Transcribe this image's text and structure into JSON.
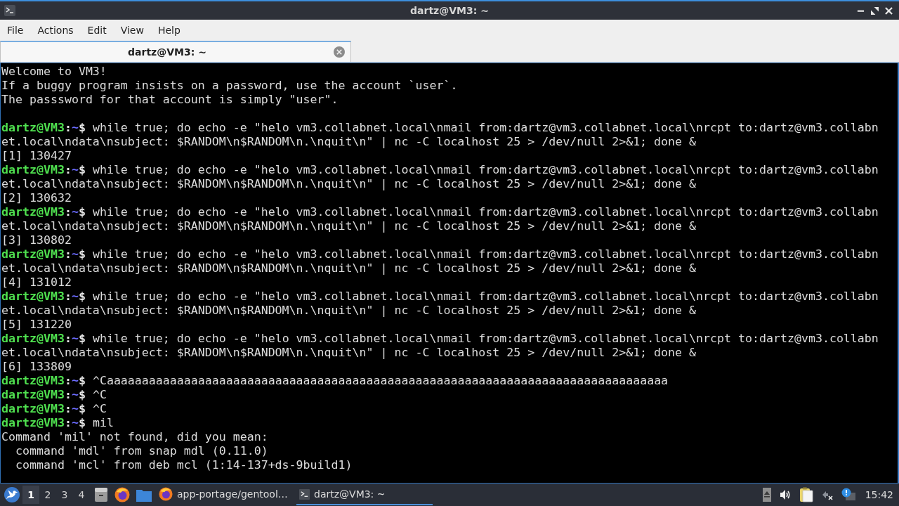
{
  "window": {
    "title": "dartz@VM3: ~"
  },
  "menu": [
    "File",
    "Actions",
    "Edit",
    "View",
    "Help"
  ],
  "tabs": [
    {
      "label": "dartz@VM3: ~",
      "selected": true
    }
  ],
  "terminal": {
    "lines": [
      {
        "kind": "output",
        "text": "Welcome to VM3!"
      },
      {
        "kind": "output",
        "text": "If a buggy program insists on a password, use the account `user`."
      },
      {
        "kind": "output",
        "text": "The passsword for that account is simply \"user\"."
      },
      {
        "kind": "blank"
      },
      {
        "kind": "prompt",
        "user": "dartz@VM3",
        "separator": ":",
        "dir": "~",
        "sign": "$",
        "command": "while true; do echo -e \"helo vm3.collabnet.local\\nmail from:dartz@vm3.collabnet.local\\nrcpt to:dartz@vm3.collabn"
      },
      {
        "kind": "output",
        "text": "et.local\\ndata\\nsubject: $RANDOM\\n$RANDOM\\n.\\nquit\\n\" | nc -C localhost 25 > /dev/null 2>&1; done &"
      },
      {
        "kind": "output",
        "text": "[1] 130427"
      },
      {
        "kind": "prompt",
        "user": "dartz@VM3",
        "separator": ":",
        "dir": "~",
        "sign": "$",
        "command": "while true; do echo -e \"helo vm3.collabnet.local\\nmail from:dartz@vm3.collabnet.local\\nrcpt to:dartz@vm3.collabn"
      },
      {
        "kind": "output",
        "text": "et.local\\ndata\\nsubject: $RANDOM\\n$RANDOM\\n.\\nquit\\n\" | nc -C localhost 25 > /dev/null 2>&1; done &"
      },
      {
        "kind": "output",
        "text": "[2] 130632"
      },
      {
        "kind": "prompt",
        "user": "dartz@VM3",
        "separator": ":",
        "dir": "~",
        "sign": "$",
        "command": "while true; do echo -e \"helo vm3.collabnet.local\\nmail from:dartz@vm3.collabnet.local\\nrcpt to:dartz@vm3.collabn"
      },
      {
        "kind": "output",
        "text": "et.local\\ndata\\nsubject: $RANDOM\\n$RANDOM\\n.\\nquit\\n\" | nc -C localhost 25 > /dev/null 2>&1; done &"
      },
      {
        "kind": "output",
        "text": "[3] 130802"
      },
      {
        "kind": "prompt",
        "user": "dartz@VM3",
        "separator": ":",
        "dir": "~",
        "sign": "$",
        "command": "while true; do echo -e \"helo vm3.collabnet.local\\nmail from:dartz@vm3.collabnet.local\\nrcpt to:dartz@vm3.collabn"
      },
      {
        "kind": "output",
        "text": "et.local\\ndata\\nsubject: $RANDOM\\n$RANDOM\\n.\\nquit\\n\" | nc -C localhost 25 > /dev/null 2>&1; done &"
      },
      {
        "kind": "output",
        "text": "[4] 131012"
      },
      {
        "kind": "prompt",
        "user": "dartz@VM3",
        "separator": ":",
        "dir": "~",
        "sign": "$",
        "command": "while true; do echo -e \"helo vm3.collabnet.local\\nmail from:dartz@vm3.collabnet.local\\nrcpt to:dartz@vm3.collabn"
      },
      {
        "kind": "output",
        "text": "et.local\\ndata\\nsubject: $RANDOM\\n$RANDOM\\n.\\nquit\\n\" | nc -C localhost 25 > /dev/null 2>&1; done &"
      },
      {
        "kind": "output",
        "text": "[5] 131220"
      },
      {
        "kind": "prompt",
        "user": "dartz@VM3",
        "separator": ":",
        "dir": "~",
        "sign": "$",
        "command": "while true; do echo -e \"helo vm3.collabnet.local\\nmail from:dartz@vm3.collabnet.local\\nrcpt to:dartz@vm3.collabn"
      },
      {
        "kind": "output",
        "text": "et.local\\ndata\\nsubject: $RANDOM\\n$RANDOM\\n.\\nquit\\n\" | nc -C localhost 25 > /dev/null 2>&1; done &"
      },
      {
        "kind": "output",
        "text": "[6] 133809"
      },
      {
        "kind": "prompt",
        "user": "dartz@VM3",
        "separator": ":",
        "dir": "~",
        "sign": "$",
        "command": "^Caaaaaaaaaaaaaaaaaaaaaaaaaaaaaaaaaaaaaaaaaaaaaaaaaaaaaaaaaaaaaaaaaaaaaaaaaaaaaaaa"
      },
      {
        "kind": "prompt",
        "user": "dartz@VM3",
        "separator": ":",
        "dir": "~",
        "sign": "$",
        "command": "^C"
      },
      {
        "kind": "prompt",
        "user": "dartz@VM3",
        "separator": ":",
        "dir": "~",
        "sign": "$",
        "command": "^C"
      },
      {
        "kind": "prompt",
        "user": "dartz@VM3",
        "separator": ":",
        "dir": "~",
        "sign": "$",
        "command": "mil"
      },
      {
        "kind": "output",
        "text": "Command 'mil' not found, did you mean:"
      },
      {
        "kind": "output",
        "text": "  command 'mdl' from snap mdl (0.11.0)"
      },
      {
        "kind": "output",
        "text": "  command 'mcl' from deb mcl (1:14-137+ds-9build1)"
      }
    ]
  },
  "taskbar": {
    "workspaces": [
      {
        "label": "1",
        "selected": true
      },
      {
        "label": "2",
        "selected": false
      },
      {
        "label": "3",
        "selected": false
      },
      {
        "label": "4",
        "selected": false
      }
    ],
    "tasks": [
      {
        "kind": "browser",
        "label": "app-portage/gentool…",
        "selected": false
      },
      {
        "kind": "terminal",
        "label": "dartz@VM3: ~",
        "selected": true
      }
    ],
    "clock": "15:42"
  }
}
